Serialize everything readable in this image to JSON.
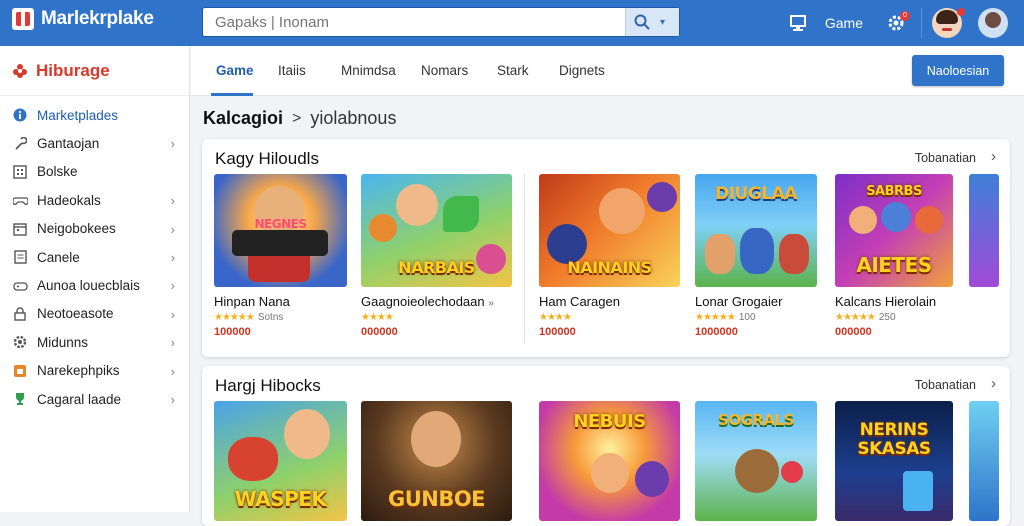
{
  "header": {
    "brand": "Marlekrplake",
    "search_placeholder": "Gapaks | Inonam",
    "game_label": "Game",
    "notif_count": "0"
  },
  "sidebar": {
    "title": "Hiburage",
    "items": [
      {
        "label": "Marketplades",
        "icon": "info-circle-icon",
        "active": true
      },
      {
        "label": "Gantaojan",
        "icon": "wrench-icon"
      },
      {
        "label": "Bolske",
        "icon": "grid-icon"
      },
      {
        "label": "Hadeokals",
        "icon": "gamepad-icon"
      },
      {
        "label": "Neigobokees",
        "icon": "calendar-icon"
      },
      {
        "label": "Canele",
        "icon": "document-icon"
      },
      {
        "label": "Aunoa louecblais",
        "icon": "controller-icon"
      },
      {
        "label": "Neotoeasote",
        "icon": "lock-icon"
      },
      {
        "label": "Midunns",
        "icon": "gear-icon"
      },
      {
        "label": "Narekephpiks",
        "icon": "store-icon"
      },
      {
        "label": "Cagaral laade",
        "icon": "trophy-icon"
      }
    ]
  },
  "tabs": [
    "Game",
    "Itaiis",
    "Mnimdsa",
    "Nomars",
    "Stark",
    "Dignets"
  ],
  "cta_label": "Naoloesian",
  "breadcrumb": {
    "root": "Kalcagioi",
    "sep": ">",
    "current": "yiolabnous"
  },
  "sections": [
    {
      "title": "Kagy Hiloudls",
      "more": "Tobanatian",
      "cards": [
        {
          "name": "Hinpan Nana",
          "stars": "★★★★★",
          "count": "Sotns",
          "price": "100000",
          "art": "NEGNES"
        },
        {
          "name": "Gaagnoieolechodaan",
          "stars": "★★★★",
          "count": "",
          "price": "000000",
          "art": "NARBAIS"
        },
        {
          "name": "Ham Caragen",
          "stars": "★★★★",
          "count": "",
          "price": "100000",
          "art": "NAINAINS"
        },
        {
          "name": "Lonar Grogaier",
          "stars": "★★★★★",
          "count": "100",
          "price": "1000000",
          "art": "DIUGLAA"
        },
        {
          "name": "Kalcans Hierolain",
          "stars": "★★★★★",
          "count": "250",
          "price": "000000",
          "art": "AIETES"
        }
      ]
    },
    {
      "title": "Hargj Hibocks",
      "more": "Tobanatian",
      "cards": [
        {
          "name": "",
          "art": "WASPEK"
        },
        {
          "name": "",
          "art": "GUNBOE"
        },
        {
          "name": "",
          "art": "NEBUIS"
        },
        {
          "name": "",
          "art": "SOGRALS"
        },
        {
          "name": "",
          "art": "NERINS SKASAS"
        }
      ]
    }
  ],
  "colors": {
    "topbar": "#2f74c9",
    "accent": "#1f5fae",
    "brand_red": "#d63a2a",
    "price_red": "#d2331f",
    "star": "#f2b01e"
  }
}
